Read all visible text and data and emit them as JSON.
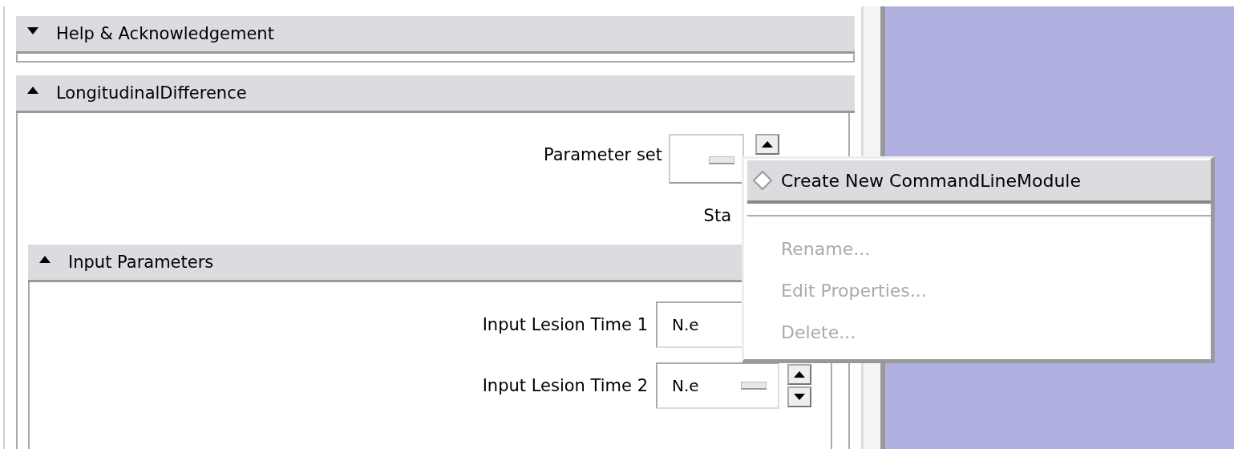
{
  "sections": [
    {
      "title": "Help & Acknowledgement",
      "expanded": false
    },
    {
      "title": "LongitudinalDifference",
      "expanded": true,
      "parameter_set": {
        "label": "Parameter set"
      },
      "status_label": "Sta",
      "subsections": [
        {
          "title": "Input Parameters",
          "expanded": true,
          "fields": [
            {
              "label": "Input Lesion Time 1",
              "value": "N.e",
              "spinner": false
            },
            {
              "label": "Input Lesion Time 2",
              "value": "N.e",
              "spinner": true
            }
          ]
        }
      ]
    }
  ],
  "popup_menu": {
    "items": [
      {
        "kind": "item",
        "label": "Create New CommandLineModule",
        "selected": true,
        "disabled": false
      },
      {
        "kind": "separator"
      },
      {
        "kind": "item",
        "label": "Rename...",
        "selected": false,
        "disabled": true
      },
      {
        "kind": "item",
        "label": "Edit Properties...",
        "selected": false,
        "disabled": true
      },
      {
        "kind": "item",
        "label": "Delete...",
        "selected": false,
        "disabled": true
      }
    ]
  }
}
